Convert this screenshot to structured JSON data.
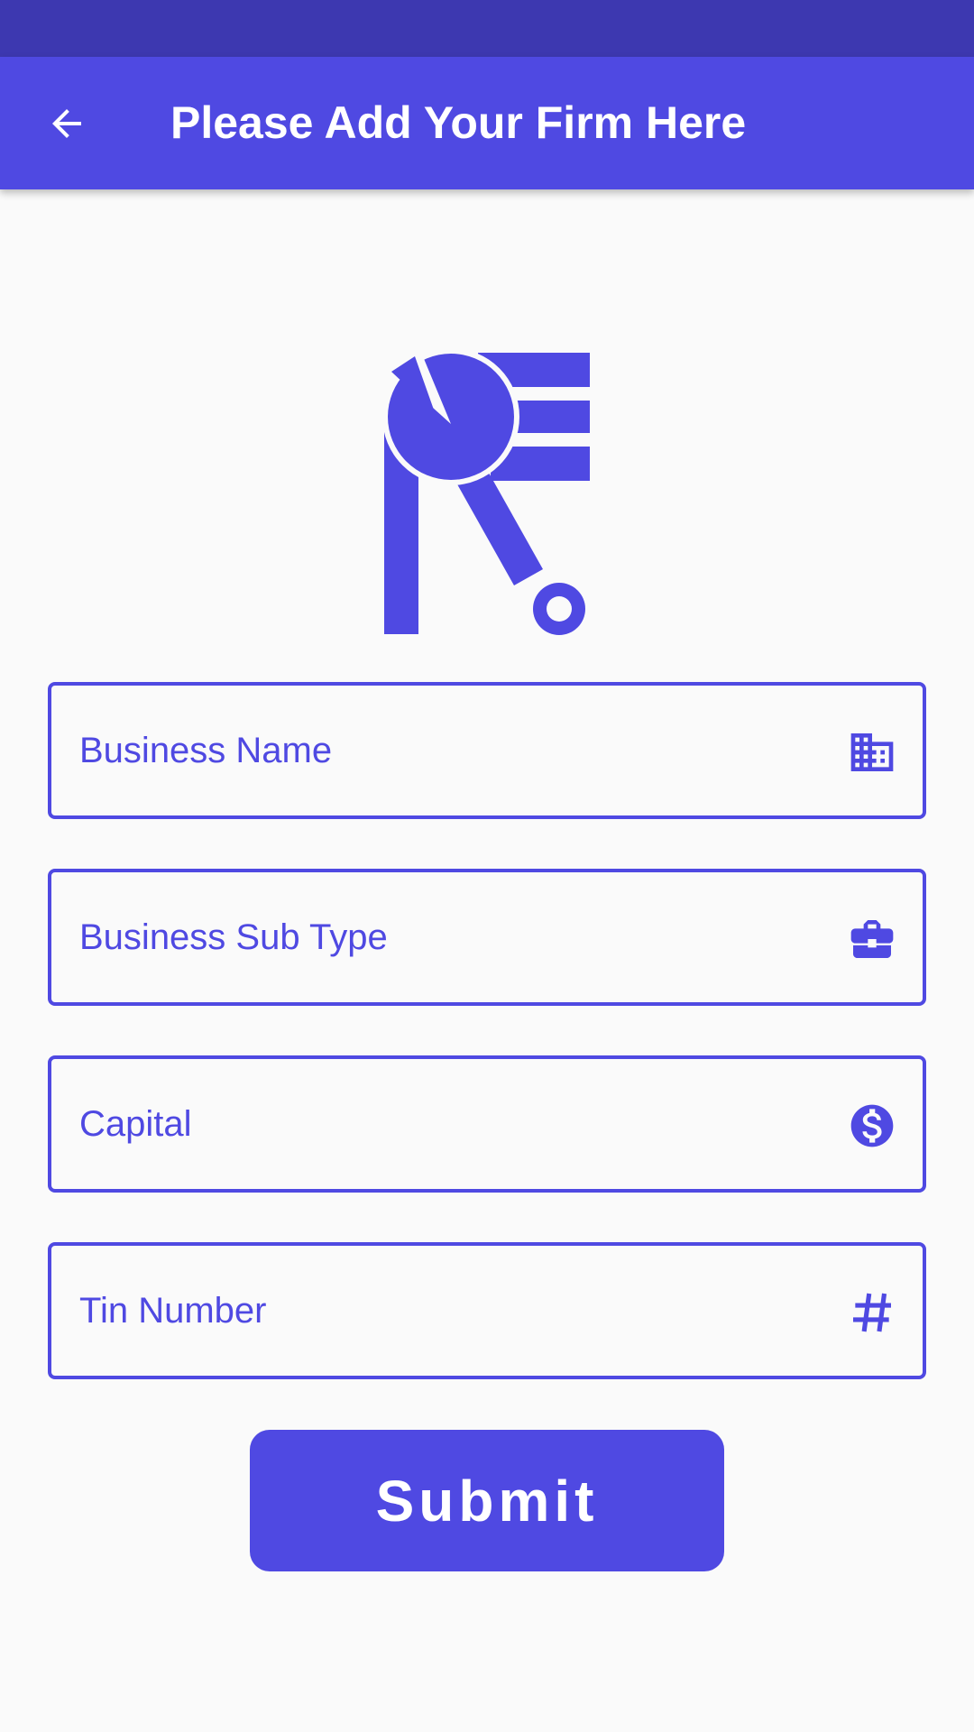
{
  "app_bar": {
    "title": "Please Add Your Firm Here",
    "back_icon": "arrow-left-icon"
  },
  "logo": {
    "icon": "rupee-wrench-logo"
  },
  "form": {
    "fields": [
      {
        "label": "Business Name",
        "icon": "building-icon",
        "value": ""
      },
      {
        "label": "Business Sub Type",
        "icon": "briefcase-icon",
        "value": ""
      },
      {
        "label": "Capital",
        "icon": "dollar-circle-icon",
        "value": ""
      },
      {
        "label": "Tin Number",
        "icon": "hash-icon",
        "value": ""
      }
    ],
    "submit_label": "Submit"
  },
  "colors": {
    "status_bar": "#3d38b0",
    "primary": "#4f49e2",
    "background": "#fafafa",
    "on_primary": "#ffffff"
  }
}
